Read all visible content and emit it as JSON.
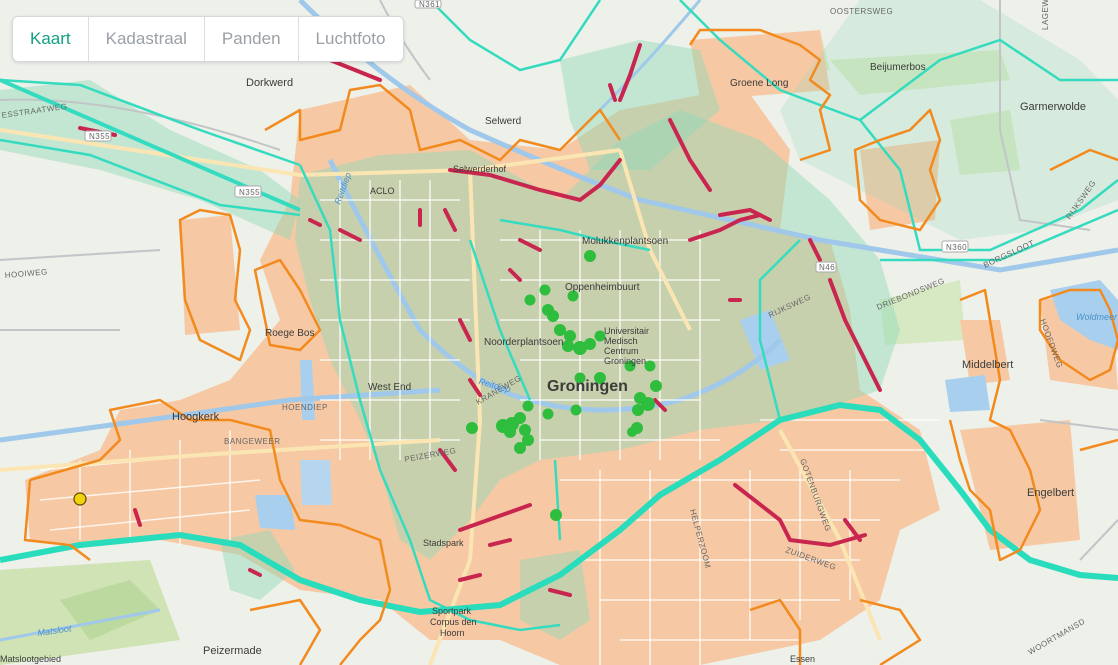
{
  "tabs": [
    {
      "label": "Kaart",
      "active": true
    },
    {
      "label": "Kadastraal",
      "active": false
    },
    {
      "label": "Panden",
      "active": false
    },
    {
      "label": "Luchtfoto",
      "active": false
    }
  ],
  "map": {
    "city": "Groningen",
    "places": {
      "dorkwerd": "Dorkwerd",
      "selwerd": "Selwerd",
      "groene_long": "Groene Long",
      "beijumerbos": "Beijumerbos",
      "garmerwolde": "Garmerwolde",
      "selwerderhof": "Selwerderhof",
      "aclo": "ACLO",
      "molukkenplantsoen": "Molukkenplantsoen",
      "oppenheimbuurt": "Oppenheimbuurt",
      "umcg_1": "Universitair",
      "umcg_2": "Medisch",
      "umcg_3": "Centrum",
      "umcg_4": "Groningen",
      "noorderplantsoen": "Noorderplantsoen",
      "roege_bos": "Roege Bos",
      "west_end": "West End",
      "hoogkerk": "Hoogkerk",
      "middelbert": "Middelbert",
      "engelbert": "Engelbert",
      "stadspark": "Stadspark",
      "sportpark_1": "Sportpark",
      "sportpark_2": "Corpus den",
      "sportpark_3": "Hoorn",
      "peizermade": "Peizermade",
      "essen": "Essen",
      "matslootgebied": "Matslootgebied"
    },
    "roads": {
      "n361": "N361",
      "n355_west": "N355",
      "n355": "N355",
      "n360": "N360",
      "n46": "N46",
      "oostersweg": "OOSTERSWEG",
      "lagewag": "LAGEWEG",
      "rijksweg_west": "RIJKSWEG",
      "rijksweg": "RIJKSWEG",
      "driebondsweg": "DRIEBONDSWEG",
      "borgsloot": "BORGSLOOT",
      "hoendiep": "HOENDIEP",
      "bangeweer": "BANGEWEER",
      "peizerweg": "PEIZERWEG",
      "kraneweg": "KRANEWEG",
      "gotenburgweg": "GOTENBURGWEG",
      "helperzoom": "HELPERZOOM",
      "hoofdweg": "HOOFDWEG",
      "woortmansdijk": "WOORTMANSD",
      "zuiderweg": "ZUIDERWEG",
      "eestraatweg": "ESSTRAATWEG",
      "hooiweg": "HOOIWEG"
    },
    "waters": {
      "reitdiep": "Reitdiep",
      "matsloot": "Matsloot",
      "koldmeer": "Woldmeer"
    }
  },
  "colors": {
    "active_tab": "#13a083",
    "urban_fill": "#f6c9a4",
    "boundary_orange": "#f28a1e",
    "zone_teal": "#35dbbf",
    "segment_red": "#c8264f",
    "point_green": "#2ebd3c",
    "point_yellow": "#f2d20f",
    "water": "#a8d0ee"
  }
}
